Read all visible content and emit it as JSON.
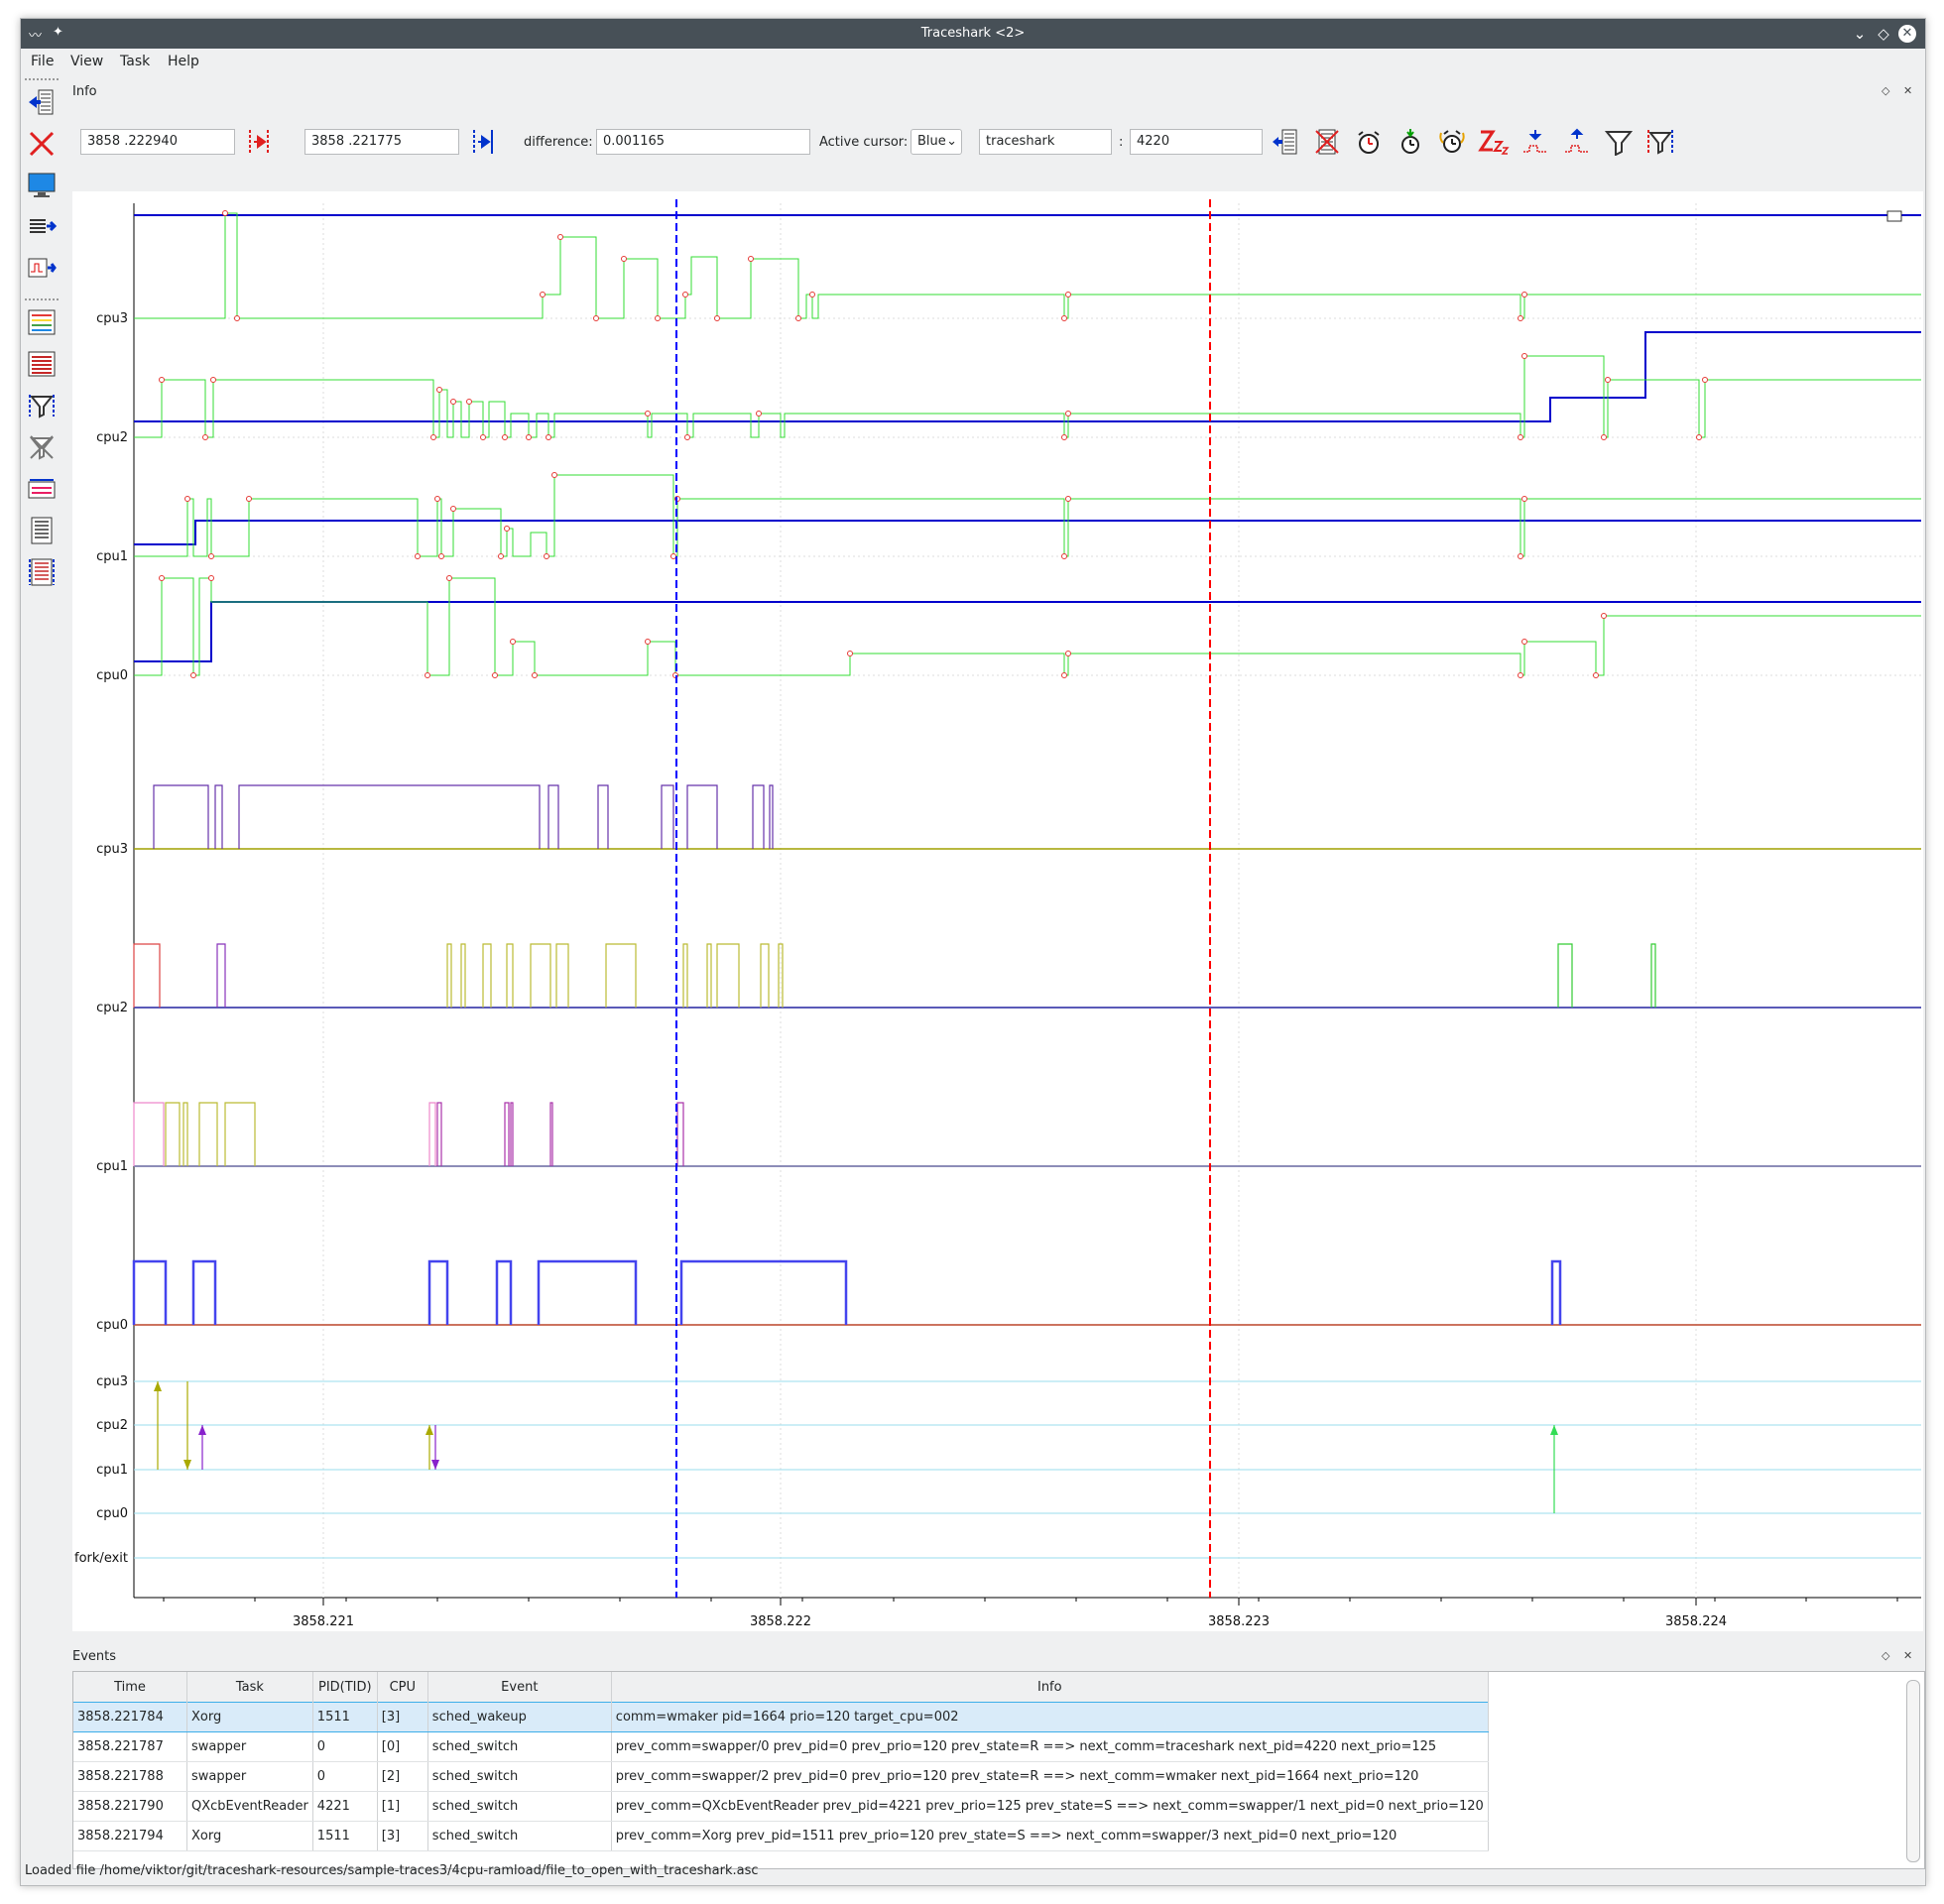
{
  "window": {
    "title": "Traceshark <2>"
  },
  "menu": {
    "file": "File",
    "view": "View",
    "task": "Task",
    "help": "Help"
  },
  "info_dock": {
    "title": "Info",
    "red_cursor_time": "3858  .222940",
    "blue_cursor_time": "3858  .221775",
    "difference_label": "difference:",
    "difference_value": "0.001165",
    "active_cursor_label": "Active cursor:",
    "active_cursor_value": "Blue",
    "task_name": "traceshark",
    "colon": ":",
    "task_pid": "4220"
  },
  "plot": {
    "cpu_labels_freq": [
      "cpu3",
      "cpu2",
      "cpu1",
      "cpu0"
    ],
    "cpu_labels_sched": [
      "cpu3",
      "cpu2",
      "cpu1",
      "cpu0"
    ],
    "cpu_labels_migration": [
      "cpu3",
      "cpu2",
      "cpu1",
      "cpu0",
      "fork/exit"
    ],
    "x_ticks": [
      "3858.221",
      "3858.222",
      "3858.223",
      "3858.224"
    ],
    "blue_cursor_time": 3858.221775,
    "red_cursor_time": 3858.22294,
    "colors": {
      "blue_cursor": "#0000ff",
      "red_cursor": "#ff0000",
      "idle_trace": "#00cc00",
      "freq_trace": "#0000cc"
    }
  },
  "events_dock": {
    "title": "Events",
    "columns": [
      "Time",
      "Task",
      "PID(TID)",
      "CPU",
      "Event",
      "Info"
    ],
    "rows": [
      [
        "3858.221784",
        "Xorg",
        "1511",
        "[3]",
        "sched_wakeup",
        "comm=wmaker pid=1664 prio=120 target_cpu=002"
      ],
      [
        "3858.221787",
        "swapper",
        "0",
        "[0]",
        "sched_switch",
        "prev_comm=swapper/0 prev_pid=0 prev_prio=120 prev_state=R ==> next_comm=traceshark next_pid=4220 next_prio=125"
      ],
      [
        "3858.221788",
        "swapper",
        "0",
        "[2]",
        "sched_switch",
        "prev_comm=swapper/2 prev_pid=0 prev_prio=120 prev_state=R ==> next_comm=wmaker next_pid=1664 next_prio=120"
      ],
      [
        "3858.221790",
        "QXcbEventReader",
        "4221",
        "[1]",
        "sched_switch",
        "prev_comm=QXcbEventReader prev_pid=4221 prev_prio=125 prev_state=S ==> next_comm=swapper/1 next_pid=0 next_prio=120"
      ],
      [
        "3858.221794",
        "Xorg",
        "1511",
        "[3]",
        "sched_switch",
        "prev_comm=Xorg prev_pid=1511 prev_prio=120 prev_state=S ==> next_comm=swapper/3 next_pid=0 next_prio=120"
      ]
    ]
  },
  "status": {
    "text": "Loaded file /home/viktor/git/traceshark-resources/sample-traces3/4cpu-ramload/file_to_open_with_traceshark.asc"
  }
}
